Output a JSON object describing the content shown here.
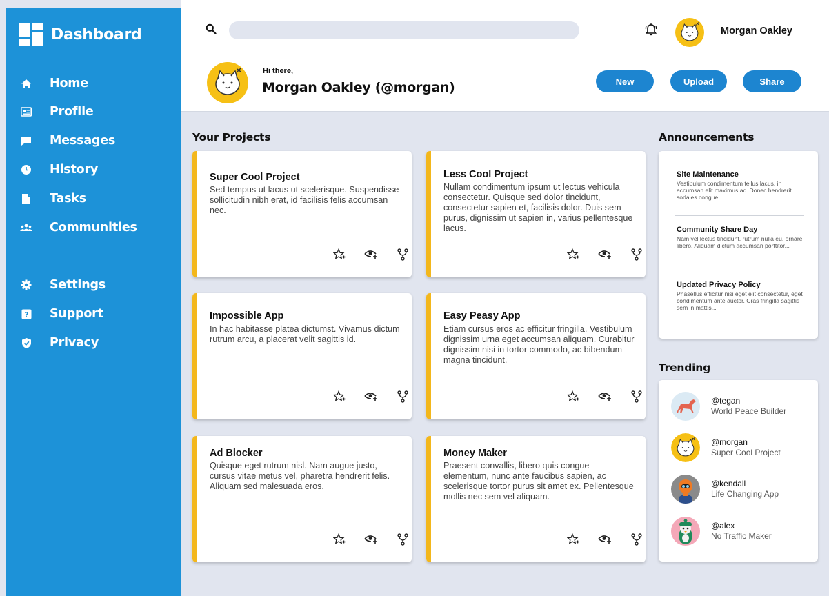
{
  "sidebar": {
    "title": "Dashboard",
    "items": [
      {
        "label": "Home",
        "icon": "home-icon"
      },
      {
        "label": "Profile",
        "icon": "id-card-icon"
      },
      {
        "label": "Messages",
        "icon": "message-icon"
      },
      {
        "label": "History",
        "icon": "clock-icon"
      },
      {
        "label": "Tasks",
        "icon": "document-icon"
      },
      {
        "label": "Communities",
        "icon": "people-icon"
      },
      {
        "label": "Settings",
        "icon": "gear-icon"
      },
      {
        "label": "Support",
        "icon": "help-icon"
      },
      {
        "label": "Privacy",
        "icon": "shield-icon"
      }
    ]
  },
  "header": {
    "user_name": "Morgan Oakley",
    "greeting_small": "Hi there,",
    "greeting_name": "Morgan Oakley (@morgan)",
    "buttons": {
      "new": "New",
      "upload": "Upload",
      "share": "Share"
    }
  },
  "projects": {
    "title": "Your Projects",
    "cards": [
      {
        "title": "Super Cool Project",
        "desc": "Sed tempus ut lacus ut scelerisque. Suspendisse sollicitudin nibh erat, id facilisis felis accumsan nec."
      },
      {
        "title": "Less Cool Project",
        "desc": "Nullam condimentum ipsum ut lectus vehicula consectetur. Quisque sed dolor tincidunt, consectetur sapien et, facilisis dolor. Duis sem purus, dignissim ut sapien in, varius pellentesque lacus."
      },
      {
        "title": "Impossible App",
        "desc": "In hac habitasse platea dictumst. Vivamus dictum rutrum arcu, a placerat velit sagittis id."
      },
      {
        "title": "Easy Peasy App",
        "desc": "Etiam cursus eros ac efficitur fringilla. Vestibulum dignissim urna eget accumsan aliquam. Curabitur dignissim nisi in tortor commodo, ac bibendum magna tincidunt."
      },
      {
        "title": "Ad Blocker",
        "desc": "Quisque eget rutrum nisl. Nam augue justo, cursus vitae metus vel, pharetra hendrerit felis. Aliquam sed malesuada eros."
      },
      {
        "title": "Money Maker",
        "desc": "Praesent convallis, libero quis congue elementum, nunc ante faucibus sapien, ac scelerisque tortor purus sit amet ex. Pellentesque mollis nec sem vel aliquam."
      }
    ]
  },
  "announcements": {
    "title": "Announcements",
    "items": [
      {
        "title": "Site Maintenance",
        "body": "Vestibulum condimentum tellus lacus, in accumsan elit maximus ac. Donec hendrerit sodales congue..."
      },
      {
        "title": "Community Share Day",
        "body": "Nam vel lectus tincidunt, rutrum nulla eu, ornare libero. Aliquam dictum accumsan porttitor..."
      },
      {
        "title": "Updated Privacy Policy",
        "body": "Phasellus efficitur nisi eget elit consectetur, eget condimentum ante auctor. Cras fringilla sagittis sem in mattis..."
      }
    ]
  },
  "trending": {
    "title": "Trending",
    "items": [
      {
        "handle": "@tegan",
        "sub": "World Peace Builder"
      },
      {
        "handle": "@morgan",
        "sub": "Super Cool Project"
      },
      {
        "handle": "@kendall",
        "sub": "Life Changing App"
      },
      {
        "handle": "@alex",
        "sub": "No Traffic Maker"
      }
    ]
  },
  "colors": {
    "sidebar": "#1d92d8",
    "button": "#1d85d0",
    "card_accent": "#f3b71c",
    "background": "#e1e5ef"
  }
}
